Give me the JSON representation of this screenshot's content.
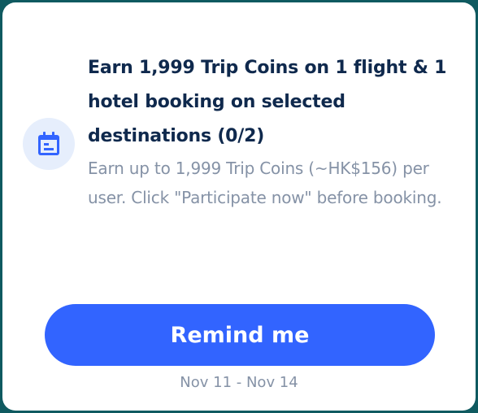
{
  "promo": {
    "icon": "calendar-icon",
    "title": "Earn 1,999 Trip Coins on 1 flight & 1 hotel booking on selected destinations (0/2)",
    "description": "Earn up to 1,999 Trip Coins (~HK$156) per user. Click \"Participate now\" before booking.",
    "button_label": "Remind me",
    "date_range": "Nov 11 - Nov 14"
  },
  "colors": {
    "primary": "#3264ff",
    "title_text": "#0f294d",
    "secondary_text": "#8592a6",
    "icon_bg": "#e6eefc",
    "frame_border": "#0f5a60"
  }
}
